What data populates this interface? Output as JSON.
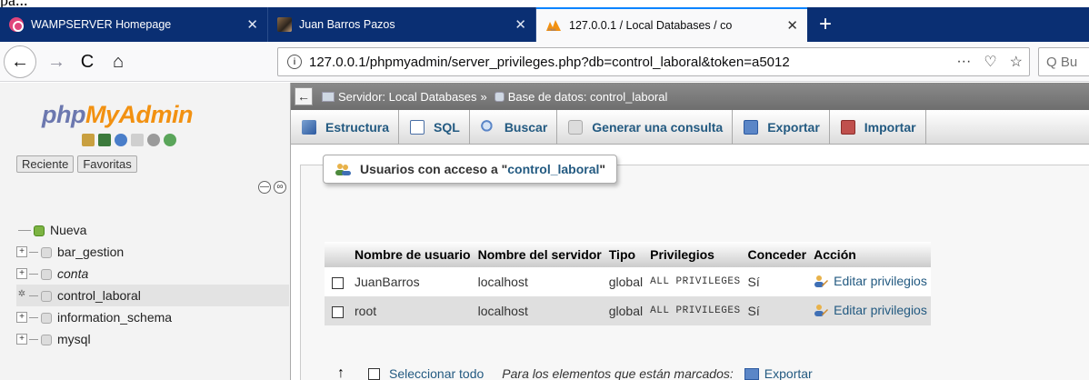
{
  "page_crop_text": "pa...",
  "tabs": [
    {
      "title": "WAMPSERVER Homepage",
      "close": "✕"
    },
    {
      "title": "Juan Barros Pazos",
      "close": "✕"
    },
    {
      "title": "127.0.0.1 / Local Databases / co",
      "close": "✕"
    }
  ],
  "new_tab": "+",
  "nav": {
    "back": "←",
    "forward": "→",
    "reload": "C",
    "home": "⌂",
    "url": "127.0.0.1/phpmyadmin/server_privileges.php?db=control_laboral&token=a5012",
    "info": "i",
    "more": "···",
    "pocket": "♡",
    "bookmark": "☆",
    "search_placeholder": "Q Bu"
  },
  "sidebar": {
    "logo_php": "php",
    "logo_myadmin": "MyAdmin",
    "tab_recent": "Reciente",
    "tab_favorites": "Favoritas",
    "collapse": "—",
    "link": "∞",
    "tree": [
      {
        "label": "Nueva"
      },
      {
        "label": "bar_gestion"
      },
      {
        "label": "conta"
      },
      {
        "label": "control_laboral"
      },
      {
        "label": "information_schema"
      },
      {
        "label": "mysql"
      }
    ]
  },
  "breadcrumb": {
    "back": "←",
    "server": "Servidor: Local Databases",
    "separator": "»",
    "database": "Base de datos: control_laboral"
  },
  "toolbar": {
    "structure": "Estructura",
    "sql": "SQL",
    "search": "Buscar",
    "query": "Generar una consulta",
    "export": "Exportar",
    "import": "Importar"
  },
  "users_panel": {
    "legend_prefix": "Usuarios con acceso a \"",
    "legend_db": "control_laboral",
    "legend_suffix": "\""
  },
  "users_table": {
    "headers": [
      "Nombre de usuario",
      "Nombre del servidor",
      "Tipo",
      "Privilegios",
      "Conceder",
      "Acción"
    ],
    "rows": [
      {
        "user": "JuanBarros",
        "host": "localhost",
        "type": "global",
        "privileges": "ALL PRIVILEGES",
        "grant": "Sí",
        "action": "Editar privilegios"
      },
      {
        "user": "root",
        "host": "localhost",
        "type": "global",
        "privileges": "ALL PRIVILEGES",
        "grant": "Sí",
        "action": "Editar privilegios"
      }
    ]
  },
  "bottom": {
    "arrow": "↑",
    "select_all": "Seleccionar todo",
    "marked": "Para los elementos que están marcados:",
    "export": "Exportar"
  }
}
